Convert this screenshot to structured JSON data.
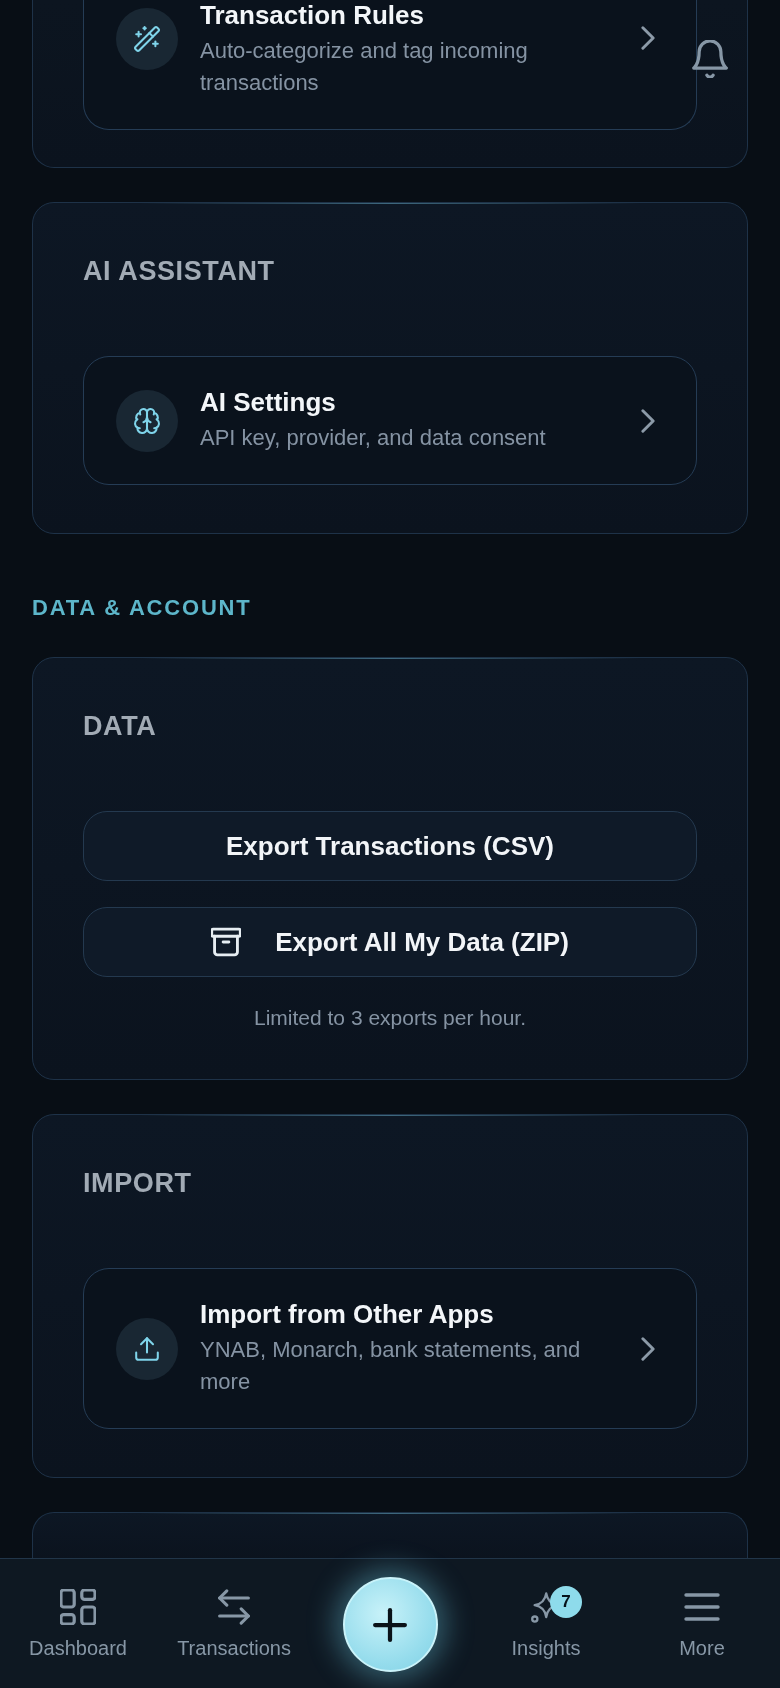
{
  "settings": [
    {
      "kind": "card",
      "items": [
        {
          "kind": "nav_row",
          "title": "Transaction Rules",
          "subtitle": "Auto-categorize and tag incoming transactions"
        }
      ]
    },
    {
      "kind": "card",
      "heading": "AI ASSISTANT",
      "items": [
        {
          "kind": "nav_row",
          "title": "AI Settings",
          "subtitle": "API key, provider, and data consent"
        }
      ]
    },
    {
      "kind": "section_label",
      "text": "DATA & ACCOUNT"
    },
    {
      "kind": "card",
      "heading": "DATA",
      "items": [
        {
          "kind": "button",
          "label": "Export Transactions (CSV)"
        },
        {
          "kind": "icon_button",
          "label": "Export All My Data (ZIP)"
        },
        {
          "kind": "note",
          "text": "Limited to 3 exports per hour."
        }
      ]
    },
    {
      "kind": "card",
      "heading": "IMPORT",
      "items": [
        {
          "kind": "nav_row",
          "title": "Import from Other Apps",
          "subtitle": "YNAB, Monarch, bank statements, and more"
        }
      ]
    },
    {
      "kind": "card"
    }
  ],
  "bottom_nav": {
    "items": [
      {
        "kind": "tab",
        "label": "Dashboard",
        "selected": false
      },
      {
        "kind": "tab",
        "label": "Transactions",
        "selected": false
      },
      {
        "kind": "action"
      },
      {
        "kind": "tab",
        "label": "Insights",
        "selected": false,
        "badge": "7"
      },
      {
        "kind": "tab",
        "label": "More",
        "selected": false
      }
    ]
  }
}
